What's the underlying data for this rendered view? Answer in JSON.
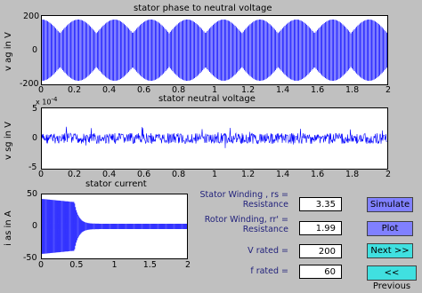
{
  "plot1": {
    "title": "stator phase to neutral voltage",
    "ylabel": "v ag in V",
    "yticks": [
      "200",
      "0",
      "-200"
    ],
    "xticks": [
      "0",
      "0.2",
      "0.4",
      "0.6",
      "0.8",
      "1",
      "1.2",
      "1.4",
      "1.6",
      "1.8",
      "2"
    ]
  },
  "plot2": {
    "title": "stator neutral voltage",
    "ylabel": "v sg in V",
    "exponent_base": "x 10",
    "exponent_power": "-4",
    "yticks": [
      "5",
      "0",
      "-5"
    ],
    "xticks": [
      "0",
      "0.2",
      "0.4",
      "0.6",
      "0.8",
      "1",
      "1.2",
      "1.4",
      "1.6",
      "1.8",
      "2"
    ]
  },
  "plot3": {
    "title": "stator current",
    "ylabel": "i as in A",
    "yticks": [
      "50",
      "0",
      "-50"
    ],
    "xticks": [
      "0",
      "0.5",
      "1",
      "1.5",
      "2"
    ]
  },
  "params": {
    "rs_label": "Stator Winding , rs =\nResistance",
    "rs_value": "3.35",
    "rr_label": "Rotor Winding, rr' =\nResistance",
    "rr_value": "1.99",
    "vrated_label": "V rated =",
    "vrated_value": "200",
    "frated_label": "f rated =",
    "frated_value": "60"
  },
  "buttons": {
    "simulate": "Simulate",
    "plot": "Plot",
    "next": "Next >>",
    "previous": "<< Previous"
  },
  "colors": {
    "trace": "#0000ff",
    "background": "#c0c0c0",
    "button_blue": "#8080ff",
    "button_cyan": "#40e0e0"
  }
}
